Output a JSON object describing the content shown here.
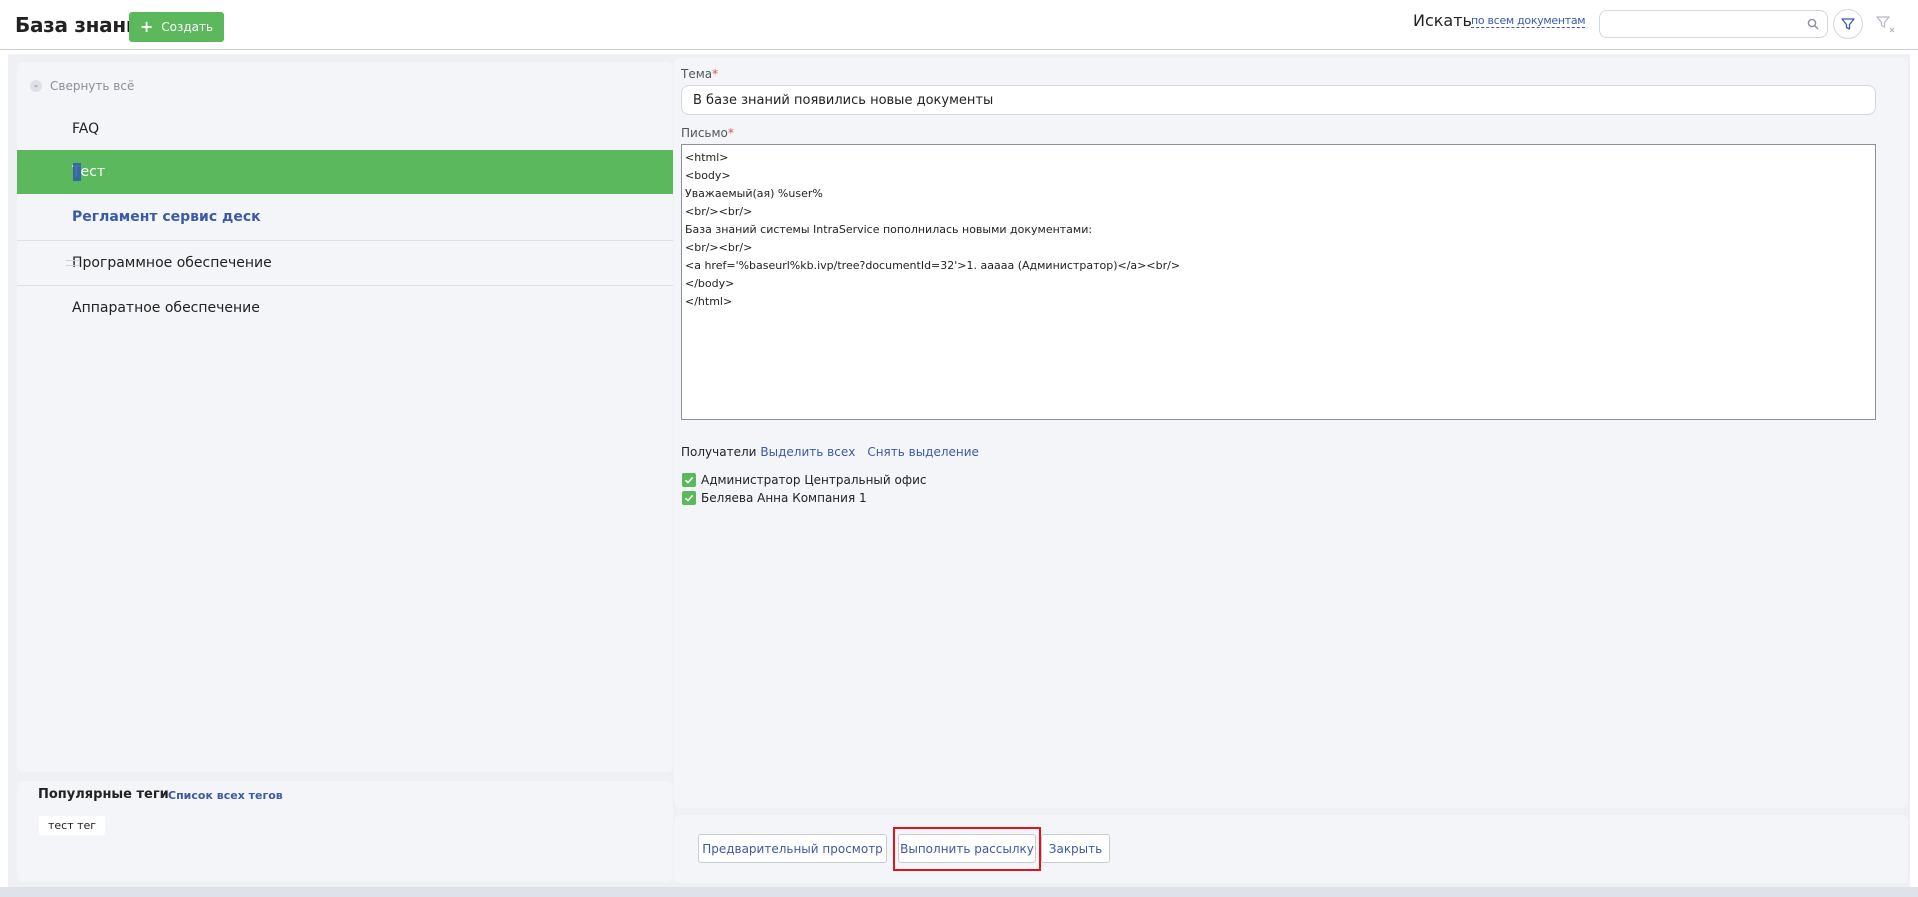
{
  "header": {
    "title": "База знаний",
    "create_label": "Создать",
    "search_label": "Искать",
    "search_scope": "по всем документам",
    "search_placeholder": ""
  },
  "tree": {
    "collapse_all": "Свернуть всё",
    "items": [
      {
        "label": "FAQ"
      },
      {
        "label": "Тест"
      },
      {
        "label": "Регламент сервис деск"
      },
      {
        "label": "Программное обеспечение"
      },
      {
        "label": "Аппаратное обеспечение"
      }
    ]
  },
  "tags": {
    "title": "Популярные теги",
    "all_link": "Список всех тегов",
    "items": [
      "тест тег"
    ]
  },
  "form": {
    "subject_label": "Тема",
    "subject_value": "В базе знаний появились новые документы",
    "letter_label": "Письмо",
    "letter_value": "<html>\n<body>\nУважаемый(ая) %user%\n<br/><br/>\nБаза знаний системы IntraService пополнилась новыми документами:\n<br/><br/>\n<a href='%baseurl%kb.ivp/tree?documentId=32'>1. ааааа (Администратор)</a><br/>\n</body>\n</html>",
    "required_mark": "*",
    "recipients_label": "Получатели",
    "select_all": "Выделить всех",
    "deselect": "Снять выделение",
    "recipients": [
      {
        "name": "Администратор Центральный офис",
        "checked": true
      },
      {
        "name": "Беляева Анна Компания 1",
        "checked": true
      }
    ]
  },
  "footer": {
    "preview_label": "Предварительный просмотр",
    "send_label": "Выполнить рассылку",
    "close_label": "Закрыть"
  },
  "colors": {
    "accent_green": "#5cb85c",
    "link_blue": "#3b5aa6",
    "highlight_red": "#e0141e"
  }
}
